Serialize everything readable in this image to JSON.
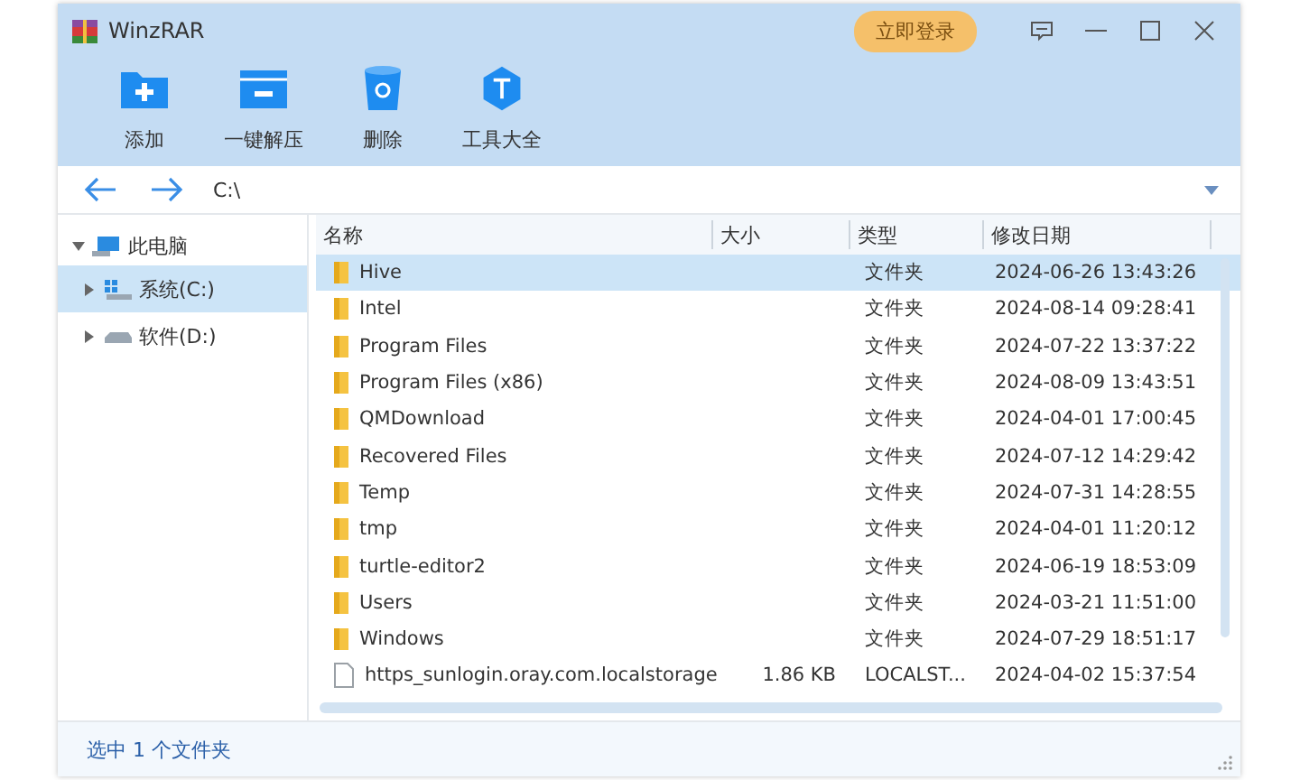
{
  "window": {
    "title": "WinzRAR",
    "login_button": "立即登录"
  },
  "toolbar": [
    {
      "label": "添加",
      "kind": "add"
    },
    {
      "label": "一键解压",
      "kind": "extract"
    },
    {
      "label": "删除",
      "kind": "delete"
    },
    {
      "label": "工具大全",
      "kind": "tools"
    }
  ],
  "address": {
    "path": "C:\\"
  },
  "sidebar": {
    "items": [
      {
        "label": "此电脑",
        "kind": "computer",
        "expanded": true,
        "selected": false,
        "children": [
          {
            "label": "系统(C:)",
            "kind": "system-drive",
            "expanded": false,
            "selected": true
          },
          {
            "label": "软件(D:)",
            "kind": "drive",
            "expanded": false,
            "selected": false
          }
        ]
      }
    ]
  },
  "table": {
    "columns": [
      "名称",
      "大小",
      "类型",
      "修改日期"
    ],
    "rows": [
      {
        "kind": "folder",
        "name": "Hive",
        "type": "文件夹",
        "date": "2024-06-26 13:43:26",
        "selected": true
      },
      {
        "kind": "folder",
        "name": "Intel",
        "type": "文件夹",
        "date": "2024-08-14 09:28:41",
        "selected": false
      },
      {
        "kind": "folder",
        "name": "Program Files",
        "type": "文件夹",
        "date": "2024-07-22 13:37:22",
        "selected": false
      },
      {
        "kind": "folder",
        "name": "Program Files (x86)",
        "type": "文件夹",
        "date": "2024-08-09 13:43:51",
        "selected": false
      },
      {
        "kind": "folder",
        "name": "QMDownload",
        "type": "文件夹",
        "date": "2024-04-01 17:00:45",
        "selected": false
      },
      {
        "kind": "folder",
        "name": "Recovered Files",
        "type": "文件夹",
        "date": "2024-07-12 14:29:42",
        "selected": false
      },
      {
        "kind": "folder",
        "name": "Temp",
        "type": "文件夹",
        "date": "2024-07-31 14:28:55",
        "selected": false
      },
      {
        "kind": "folder",
        "name": "tmp",
        "type": "文件夹",
        "date": "2024-04-01 11:20:12",
        "selected": false
      },
      {
        "kind": "folder",
        "name": "turtle-editor2",
        "type": "文件夹",
        "date": "2024-06-19 18:53:09",
        "selected": false
      },
      {
        "kind": "folder",
        "name": "Users",
        "type": "文件夹",
        "date": "2024-03-21 11:51:00",
        "selected": false
      },
      {
        "kind": "folder",
        "name": "Windows",
        "type": "文件夹",
        "date": "2024-07-29 18:51:17",
        "selected": false
      },
      {
        "kind": "file",
        "name": "https_sunlogin.oray.com.localstorage",
        "size": "1.86 KB",
        "type": "LOCALST...",
        "date": "2024-04-02 15:37:54",
        "selected": false
      }
    ]
  },
  "status_bar": {
    "text": "选中 1 个文件夹"
  }
}
